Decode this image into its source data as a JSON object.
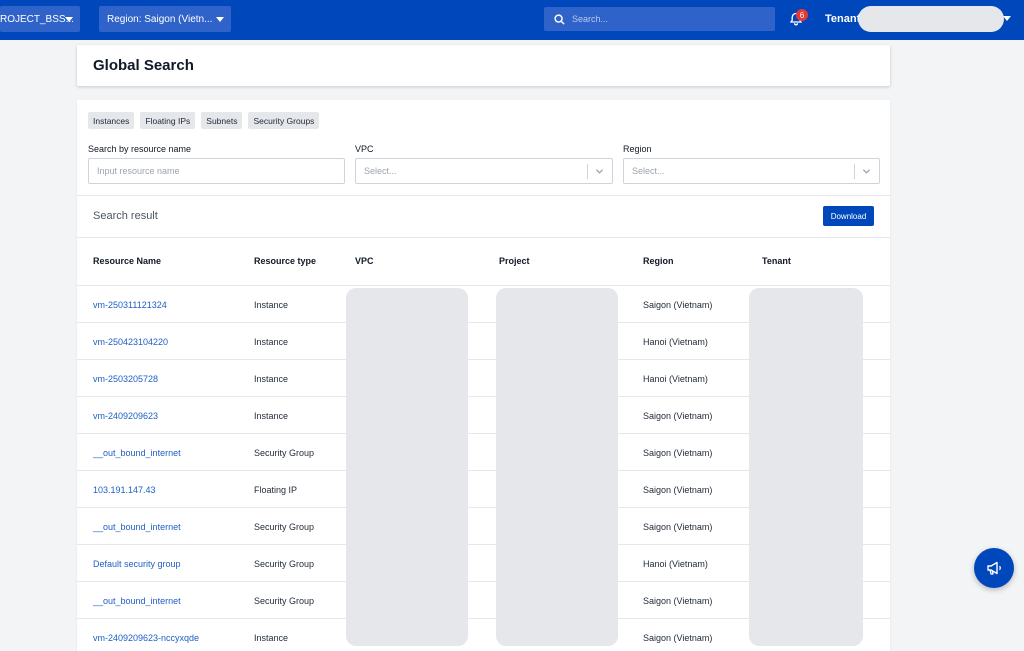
{
  "topbar": {
    "project": "ROJECT_BSS...",
    "region": "Region: Saigon (Vietn...",
    "search_placeholder": "Search...",
    "notification_count": "6",
    "tenant_label": "Tenant:"
  },
  "page": {
    "title": "Global Search"
  },
  "tabs": [
    "Instances",
    "Floating IPs",
    "Subnets",
    "Security Groups"
  ],
  "filters": {
    "name_label": "Search by resource name",
    "name_placeholder": "Input resource name",
    "vpc_label": "VPC",
    "vpc_value": "Select...",
    "region_label": "Region",
    "region_value": "Select..."
  },
  "results": {
    "title": "Search result",
    "download_label": "Download",
    "columns": [
      "Resource Name",
      "Resource type",
      "VPC",
      "Project",
      "Region",
      "Tenant"
    ],
    "rows": [
      {
        "name": "vm-250311121324",
        "type": "Instance",
        "region": "Saigon (Vietnam)"
      },
      {
        "name": "vm-250423104220",
        "type": "Instance",
        "region": "Hanoi (Vietnam)"
      },
      {
        "name": "vm-2503205728",
        "type": "Instance",
        "region": "Hanoi (Vietnam)"
      },
      {
        "name": "vm-2409209623",
        "type": "Instance",
        "region": "Saigon (Vietnam)"
      },
      {
        "name": "__out_bound_internet",
        "type": "Security Group",
        "region": "Saigon (Vietnam)"
      },
      {
        "name": "103.191.147.43",
        "type": "Floating IP",
        "region": "Saigon (Vietnam)"
      },
      {
        "name": "__out_bound_internet",
        "type": "Security Group",
        "region": "Saigon (Vietnam)"
      },
      {
        "name": "Default security group",
        "type": "Security Group",
        "region": "Hanoi (Vietnam)"
      },
      {
        "name": "__out_bound_internet",
        "type": "Security Group",
        "region": "Saigon (Vietnam)"
      },
      {
        "name": "vm-2409209623-nccyxqde",
        "type": "Instance",
        "region": "Saigon (Vietnam)"
      }
    ]
  },
  "colors": {
    "primary": "#0047bb",
    "link": "#1d5fc4"
  }
}
